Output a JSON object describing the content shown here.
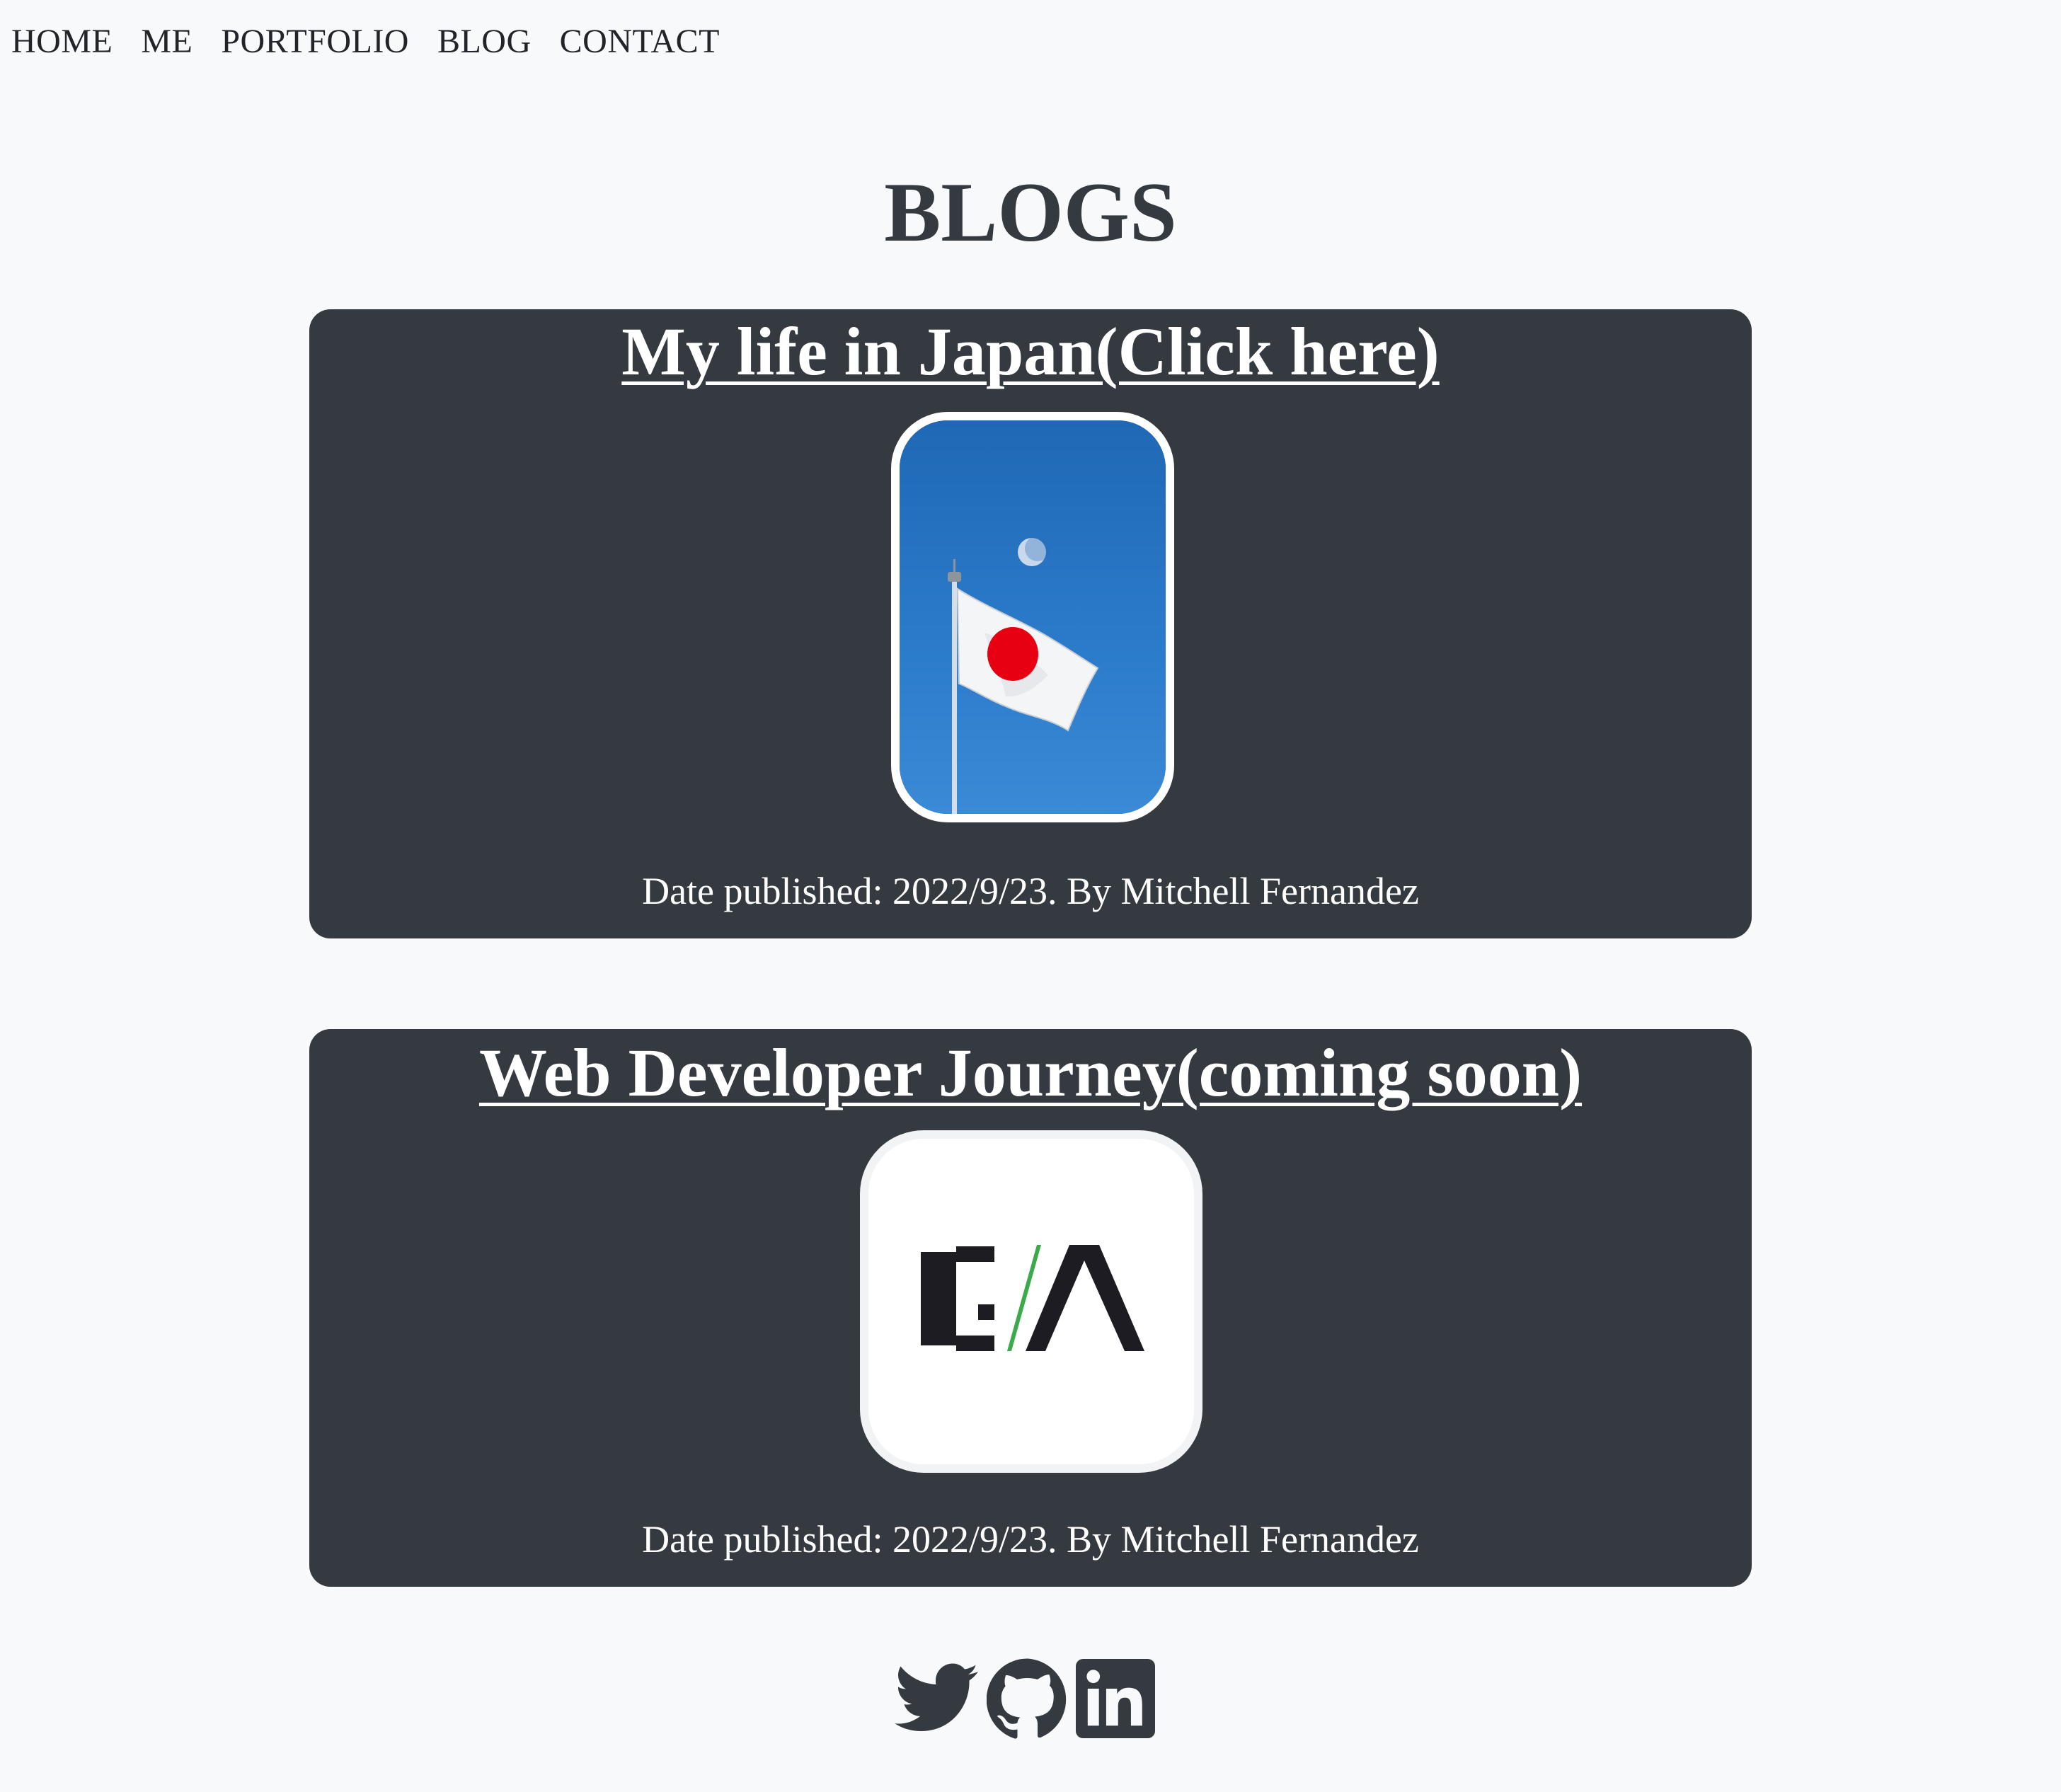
{
  "nav": {
    "items": [
      {
        "label": "HOME"
      },
      {
        "label": "ME"
      },
      {
        "label": "PORTFOLIO"
      },
      {
        "label": "BLOG"
      },
      {
        "label": "CONTACT"
      }
    ]
  },
  "page": {
    "title": "BLOGS"
  },
  "blogs": [
    {
      "title": "My life in Japan(Click here)",
      "image_icon": "japan-flag-photo",
      "meta": "Date published: 2022/9/23. By Mitchell Fernandez"
    },
    {
      "title": "Web Developer Journey(coming soon)",
      "image_icon": "ca-logo",
      "meta": "Date published: 2022/9/23. By Mitchell Fernandez"
    }
  ],
  "footer": {
    "social": [
      {
        "icon": "twitter-icon"
      },
      {
        "icon": "github-icon"
      },
      {
        "icon": "linkedin-icon"
      }
    ]
  },
  "colors": {
    "background": "#f8f9fa",
    "card": "#343a40",
    "text_dark": "#343a40",
    "text_light": "#ffffff",
    "accent_green": "#3aaa4a",
    "flag_red": "#e60012",
    "sky_blue": "#2a76c4"
  }
}
